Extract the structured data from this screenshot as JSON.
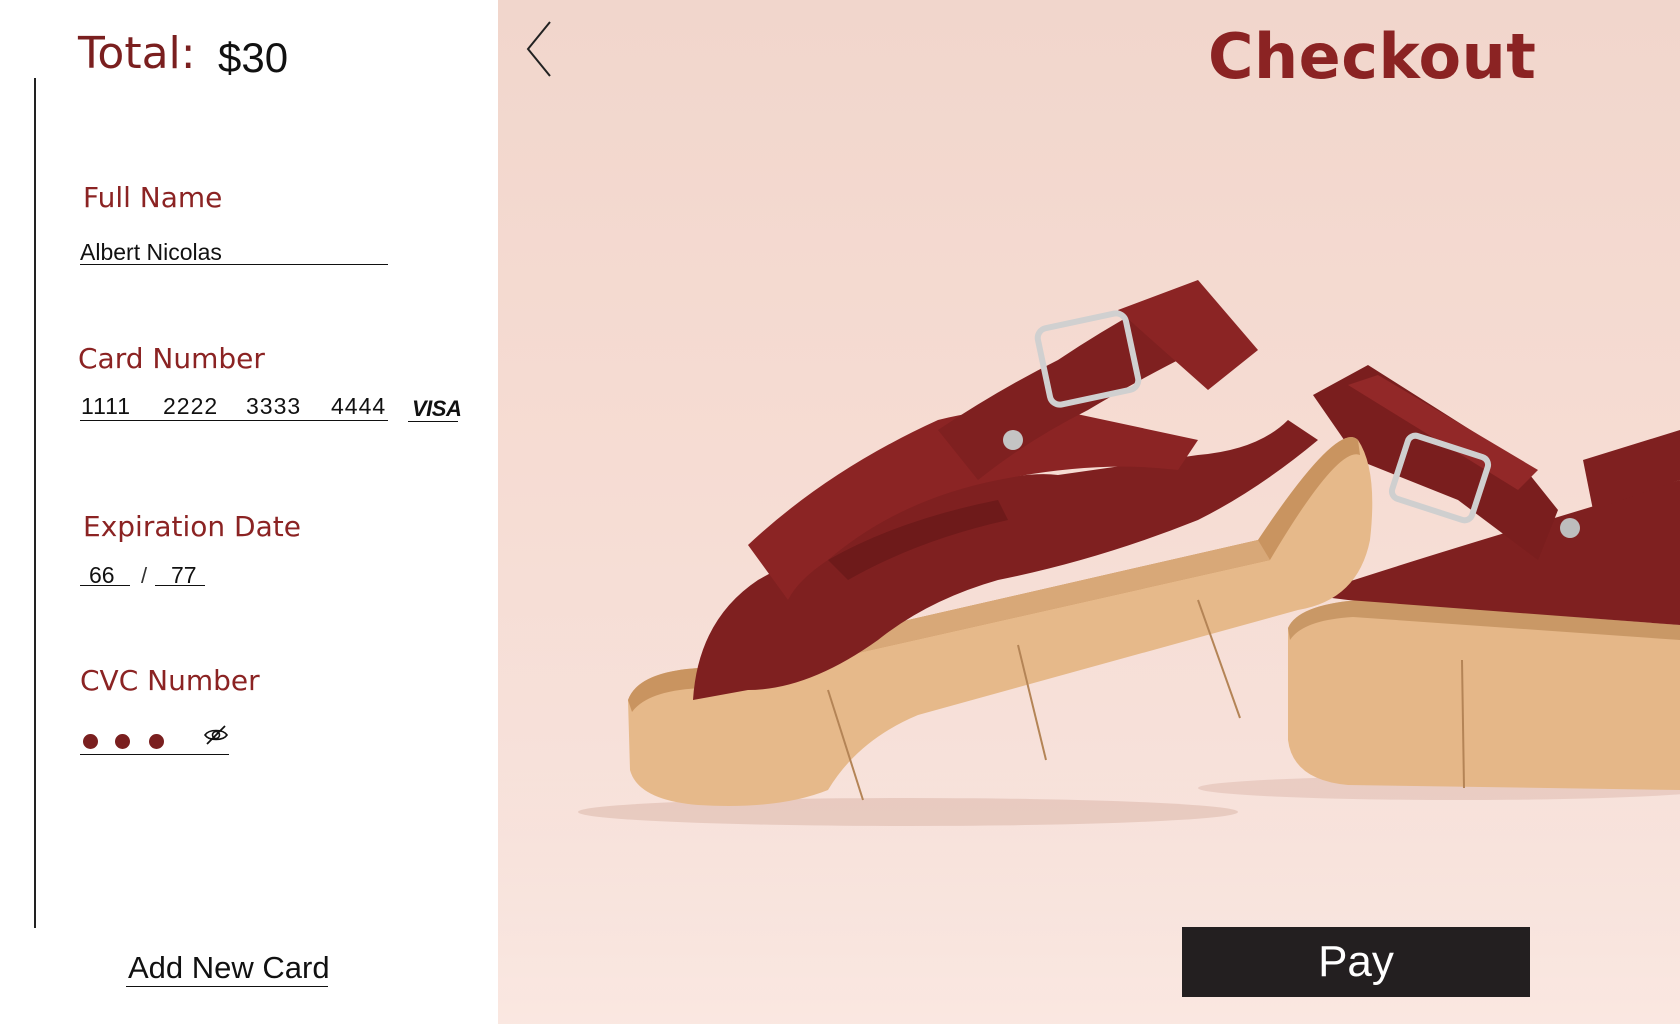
{
  "summary": {
    "total_label": "Total:",
    "total_value": "$30"
  },
  "form": {
    "full_name": {
      "label": "Full Name",
      "value": "Albert Nicolas"
    },
    "card_number": {
      "label": "Card Number",
      "segments": [
        "1111",
        "2222",
        "3333",
        "4444"
      ],
      "brand": "VISA"
    },
    "expiration": {
      "label": "Expiration Date",
      "month": "66",
      "separator": "/",
      "year": "77"
    },
    "cvc": {
      "label": "CVC Number",
      "masked_dots": 3,
      "toggle_icon": "eye-off-icon"
    }
  },
  "actions": {
    "add_card_label": "Add New Card",
    "pay_label": "Pay"
  },
  "header": {
    "title": "Checkout",
    "back_icon": "chevron-left-icon"
  },
  "colors": {
    "accent": "#8b2323",
    "pay_button": "#231f20",
    "hero_background": "#f4dcd3",
    "sandal_leather": "#7f2020",
    "sole_wood": "#e6b98a"
  }
}
